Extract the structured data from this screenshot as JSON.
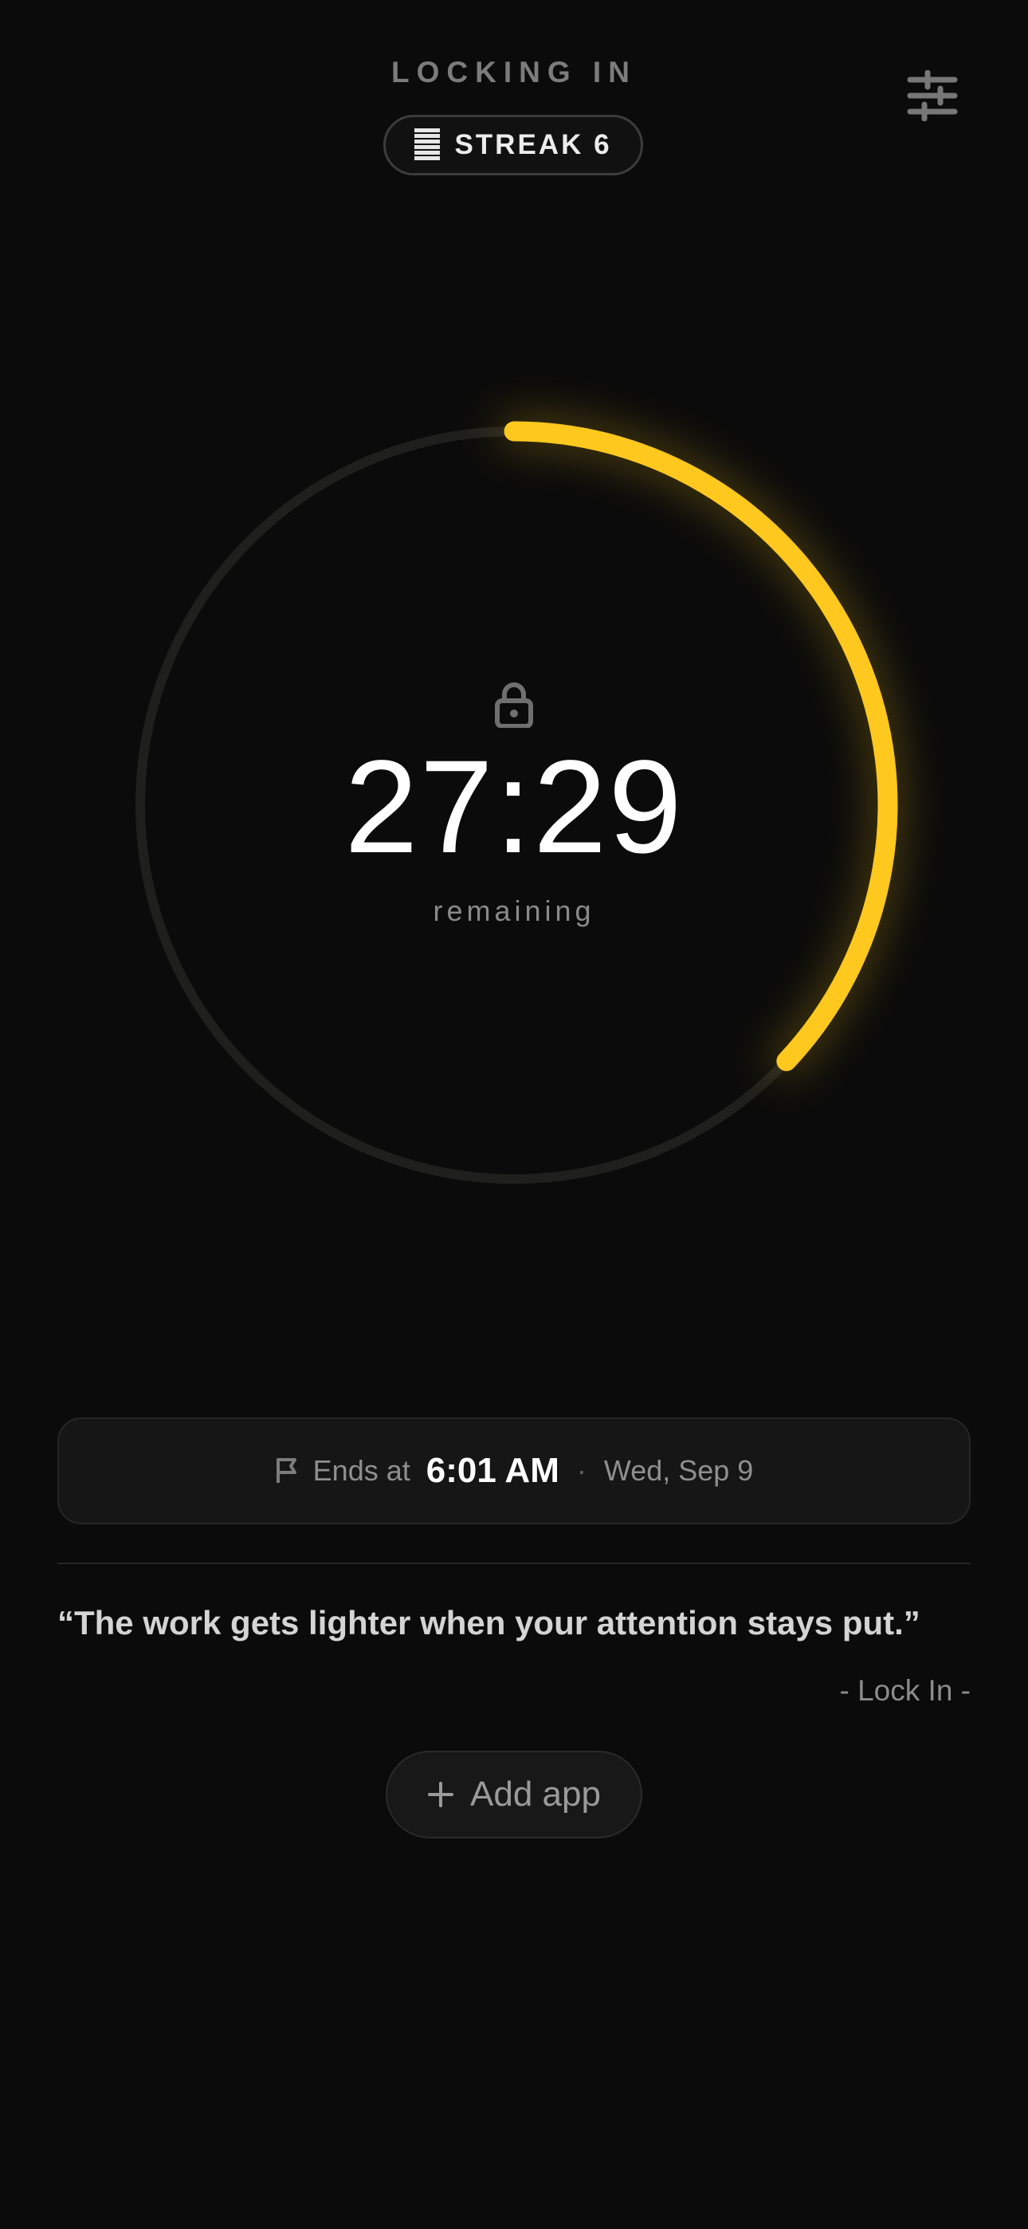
{
  "header": {
    "title": "LOCKING IN",
    "settings_icon": "sliders-icon"
  },
  "streak": {
    "icon": "flame-bars-icon",
    "label": "STREAK 6"
  },
  "timer": {
    "time_remaining": "27:29",
    "remaining_label": "remaining",
    "lock_icon": "lock-icon",
    "progress_fraction": 0.37,
    "accent_color": "#FFC81E",
    "track_color": "#1f1f1d"
  },
  "ends": {
    "icon": "flag-icon",
    "prefix": "Ends at",
    "time": "6:01 AM",
    "separator": "·",
    "date": "Wed, Sep 9"
  },
  "quote": {
    "text": "“The work gets lighter when your attention stays put.”",
    "author": "- Lock In -"
  },
  "add_app": {
    "icon": "plus-icon",
    "label": "Add app"
  }
}
